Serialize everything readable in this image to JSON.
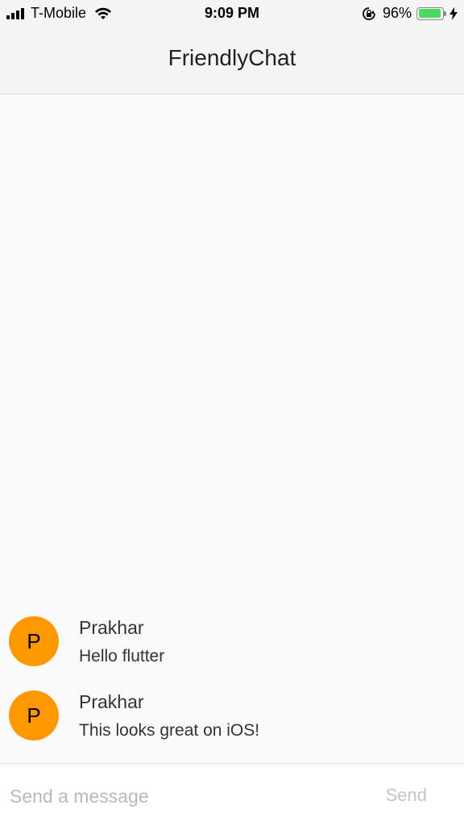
{
  "status_bar": {
    "carrier": "T-Mobile",
    "time": "9:09 PM",
    "battery_percent": "96%",
    "battery_level": 0.96,
    "icons": [
      "signal-icon",
      "wifi-icon",
      "rotation-lock-icon",
      "battery-icon",
      "charging-icon"
    ]
  },
  "app_bar": {
    "title": "FriendlyChat"
  },
  "messages": [
    {
      "avatar_letter": "P",
      "sender": "Prakhar",
      "text": "Hello flutter"
    },
    {
      "avatar_letter": "P",
      "sender": "Prakhar",
      "text": "This looks great on iOS!"
    }
  ],
  "composer": {
    "placeholder": "Send a message",
    "value": "",
    "send_label": "Send"
  },
  "colors": {
    "avatar": "#ff9800",
    "battery_fill": "#4cd964",
    "send_disabled": "#c4c4c4"
  }
}
